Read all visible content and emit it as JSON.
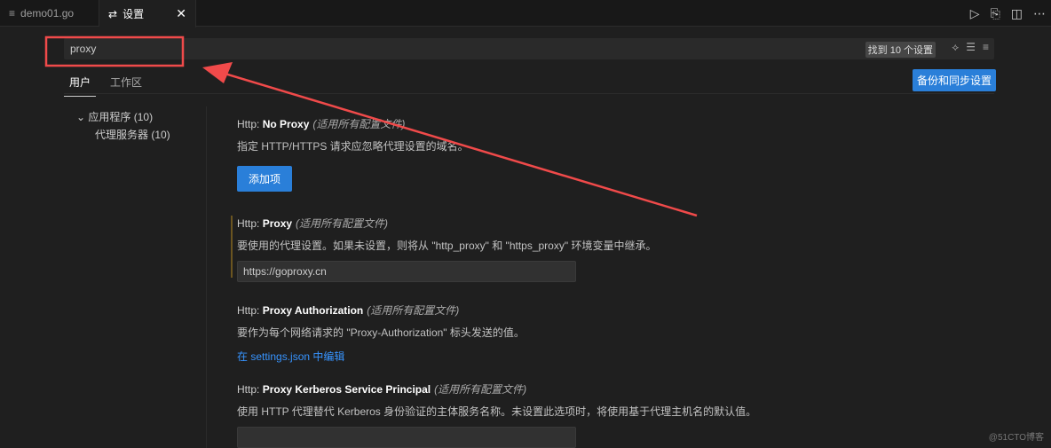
{
  "tabs": [
    {
      "label": "demo01.go",
      "icon": "file-lines-icon"
    },
    {
      "label": "设置",
      "icon": "settings-sliders-icon",
      "close": "✕"
    }
  ],
  "search": {
    "value": "proxy",
    "result_count": "找到 10 个设置"
  },
  "scopes": [
    "用户",
    "工作区"
  ],
  "sync_button": "备份和同步设置",
  "toc": {
    "group": "应用程序 (10)",
    "item": "代理服务器 (10)"
  },
  "settings": [
    {
      "category": "Http: ",
      "name": "No Proxy",
      "scope": "(适用所有配置文件)",
      "description": "指定 HTTP/HTTPS 请求应忽略代理设置的域名。",
      "button": "添加项"
    },
    {
      "category": "Http: ",
      "name": "Proxy",
      "scope": "(适用所有配置文件)",
      "description": "要使用的代理设置。如果未设置，则将从 \"http_proxy\" 和 \"https_proxy\" 环境变量中继承。",
      "value": "https://goproxy.cn"
    },
    {
      "category": "Http: ",
      "name": "Proxy Authorization",
      "scope": "(适用所有配置文件)",
      "description": "要作为每个网络请求的 \"Proxy-Authorization\" 标头发送的值。",
      "link": "在 settings.json 中编辑"
    },
    {
      "category": "Http: ",
      "name": "Proxy Kerberos Service Principal",
      "scope": "(适用所有配置文件)",
      "description": "使用 HTTP 代理替代 Kerberos 身份验证的主体服务名称。未设置此选项时，将使用基于代理主机名的默认值。",
      "value": ""
    }
  ],
  "watermark": "@51CTO博客",
  "colors": {
    "accent": "#2a7fd9",
    "annotation": "#f04a4a"
  }
}
